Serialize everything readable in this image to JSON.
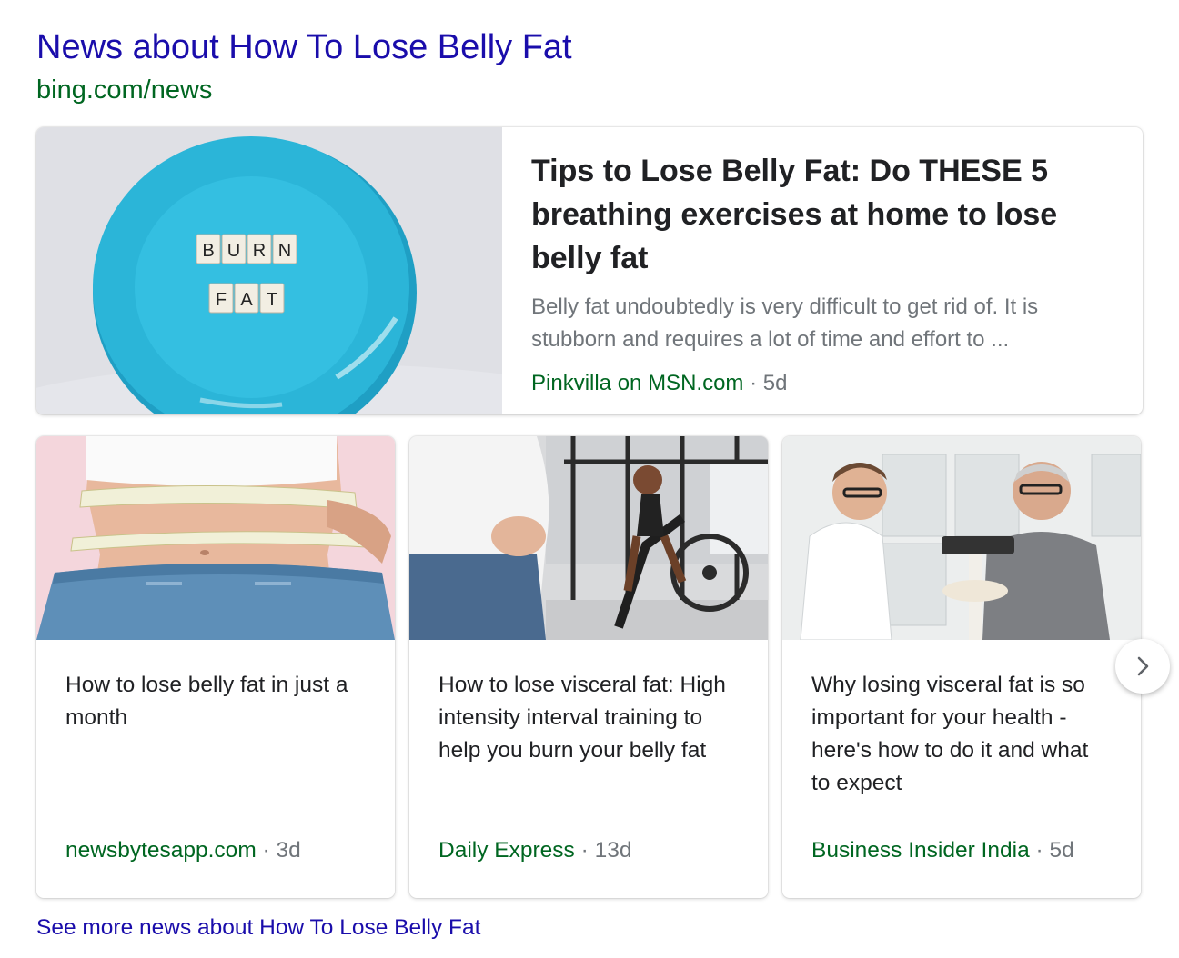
{
  "header": {
    "title": "News about How To Lose Belly Fat",
    "url": "bing.com/news"
  },
  "featured": {
    "title": "Tips to Lose Belly Fat: Do THESE 5 breathing exercises at home to lose belly fat",
    "snippet": "Belly fat undoubtedly is very difficult to get rid of. It is stubborn and requires a lot of time and effort to ...",
    "source": "Pinkvilla on MSN.com",
    "age": "5d",
    "image": {
      "tile_word_1": "BURN",
      "tile_word_2": "FAT",
      "plate_color": "#2bb5d8"
    }
  },
  "articles": [
    {
      "title": "How to lose belly fat in just a month",
      "source": "newsbytesapp.com",
      "age": "3d"
    },
    {
      "title": "How to lose visceral fat: High intensity interval training to help you burn your belly fat",
      "source": "Daily Express",
      "age": "13d"
    },
    {
      "title": "Why losing visceral fat is so important for your health - here's how to do it and what to expect",
      "source": "Business Insider India",
      "age": "5d"
    }
  ],
  "separator": "·",
  "see_more": "See more news about How To Lose Belly Fat",
  "colors": {
    "link": "#1a0dab",
    "source": "#006621",
    "muted": "#70757a",
    "text": "#202124"
  }
}
